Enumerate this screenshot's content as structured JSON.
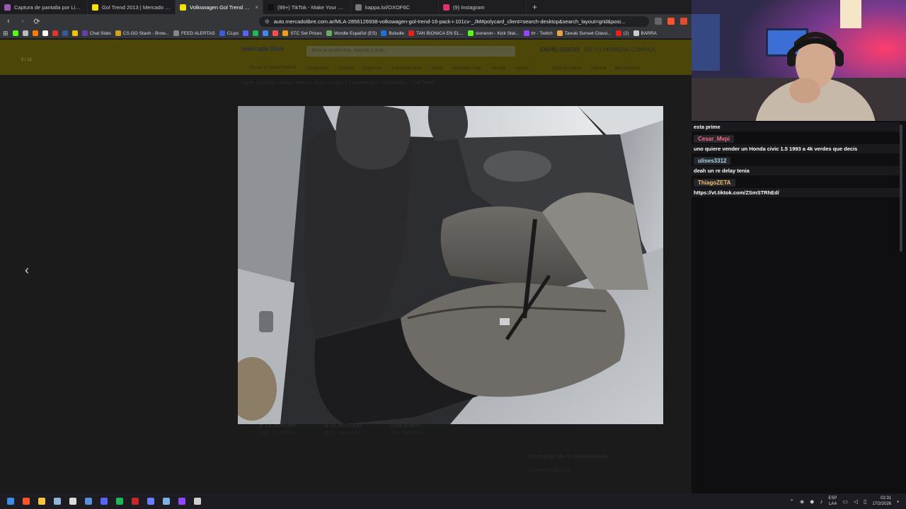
{
  "browser": {
    "tabs": [
      {
        "title": "Captura de pantalla por Lightshot",
        "color": "#9b59b6",
        "active": false
      },
      {
        "title": "Gol Trend 2013 | Mercado Libre",
        "color": "#f2e20b",
        "active": false
      },
      {
        "title": "Volkswagen Gol Trend 1.6 Pack I...",
        "color": "#f2e20b",
        "active": true
      },
      {
        "title": "(99+) TikTok - Make Your Day",
        "color": "#111111",
        "active": false
      },
      {
        "title": "kappa.lol/OXOF6C",
        "color": "#777777",
        "active": false
      },
      {
        "title": "(9) Instagram",
        "color": "#e1306c",
        "active": false
      }
    ],
    "new_tab": "+",
    "url": "auto.mercadolibre.com.ar/MLA-2856126938-volkswagen-gol-trend-16-pack-i-101cv-_JM#polycard_client=search-desktop&search_layout=grid&posi...",
    "bookmarks": [
      {
        "label": "",
        "color": "#53fc18"
      },
      {
        "label": "",
        "color": "#bbbbbb"
      },
      {
        "label": "",
        "color": "#ff7a00"
      },
      {
        "label": "",
        "color": "#ffffff"
      },
      {
        "label": "",
        "color": "#e5352b"
      },
      {
        "label": "",
        "color": "#3b5998"
      },
      {
        "label": "",
        "color": "#f2c300"
      },
      {
        "label": "Chat Stats",
        "color": "#6441a5"
      },
      {
        "label": "CS.GO Stash - Brow...",
        "color": "#d4a017"
      },
      {
        "label": "FEED ALERTAS",
        "color": "#888888"
      },
      {
        "label": "CLips",
        "color": "#3b5bdb"
      },
      {
        "label": "",
        "color": "#5865f2"
      },
      {
        "label": "",
        "color": "#1db954"
      },
      {
        "label": "",
        "color": "#4285f4"
      },
      {
        "label": "",
        "color": "#ff4d4d"
      },
      {
        "label": "STC Set Prices",
        "color": "#f39c12"
      },
      {
        "label": "Wordle Español (ES)",
        "color": "#6aaa64"
      },
      {
        "label": "Boludle",
        "color": "#1e6fd9"
      },
      {
        "label": "TAN BIONICA EN EL...",
        "color": "#e62117"
      },
      {
        "label": "sioneron - Kick Stat...",
        "color": "#53fc18"
      },
      {
        "label": "trr - Twitch",
        "color": "#9146ff"
      },
      {
        "label": "Tanuki Sunset Classi...",
        "color": "#e8a33d"
      },
      {
        "label": "(2)",
        "color": "#e62117"
      },
      {
        "label": "BARRA",
        "color": "#cccccc"
      }
    ]
  },
  "page": {
    "counter": "5 / 12",
    "logo": "mercado libre",
    "search_placeholder": "Buscar productos, marcas y más...",
    "promo_a": "ENVÍO GRATIS",
    "promo_b": "EN TU PRIMERA COMPRA",
    "address": "Enviar a Capital Federal",
    "nav": [
      "Categorías",
      "Ofertas",
      "Cupones",
      "Supermercado",
      "Moda",
      "Mercado Play",
      "Vender",
      "Ayuda"
    ],
    "account": [
      "Creá tu cuenta",
      "Ingresá",
      "Mis compras"
    ],
    "breadcrumb": "Volver al listado  |  Autos, Motos y Otros > Autos y Camionetas > Volkswagen > Gol Trend",
    "prices": [
      {
        "price": "$ 12.300.000",
        "sub": "2015 · 107.000 km"
      },
      {
        "price": "$ 11.500.000",
        "sub": "2017 · 165.000 km"
      },
      {
        "price": "US$ 8.500",
        "sub": "2014 · 187.000 km"
      }
    ],
    "seller_title": "Información de la concesionaria",
    "seller_sub": "Automotores Buenos"
  },
  "lightbox": {
    "prev": "‹",
    "next": "›"
  },
  "chat": {
    "messages": [
      {
        "user": "",
        "text": "esta prime",
        "color": "#ffffff"
      },
      {
        "user": "Cesar_Mvpi",
        "text": "uno quiere vender un Honda civic 1.5 1993 a 4k verdes que decis",
        "color": "#ff6b8a"
      },
      {
        "user": "ulises3312",
        "text": "deah un re delay tenia",
        "color": "#a8d8ea"
      },
      {
        "user": "ThiagoZETA",
        "text": "https://vt.tiktok.com/ZSmSTRhEd/",
        "color": "#f5c16c"
      }
    ]
  },
  "taskbar": {
    "icons": [
      {
        "name": "windows-start-icon",
        "color": "#3a8ee6"
      },
      {
        "name": "brave-browser-icon",
        "color": "#fb542b"
      },
      {
        "name": "file-explorer-icon",
        "color": "#f4c542"
      },
      {
        "name": "steam-icon",
        "color": "#8fb7d8"
      },
      {
        "name": "obs-icon",
        "color": "#d9d9d9"
      },
      {
        "name": "monitor-icon",
        "color": "#5a8fd8"
      },
      {
        "name": "discord-icon",
        "color": "#5865f2"
      },
      {
        "name": "spotify-icon",
        "color": "#1db954"
      },
      {
        "name": "recording-icon",
        "color": "#c62828"
      },
      {
        "name": "vpn-icon",
        "color": "#6a7cff"
      },
      {
        "name": "network-app-icon",
        "color": "#7fb1e6"
      },
      {
        "name": "twitch-icon",
        "color": "#9146ff"
      },
      {
        "name": "refresh-app-icon",
        "color": "#cfcfcf"
      }
    ],
    "lang": "ESP",
    "lang_sub": "LAA",
    "time": "02:31",
    "date": "17/2/2026"
  }
}
